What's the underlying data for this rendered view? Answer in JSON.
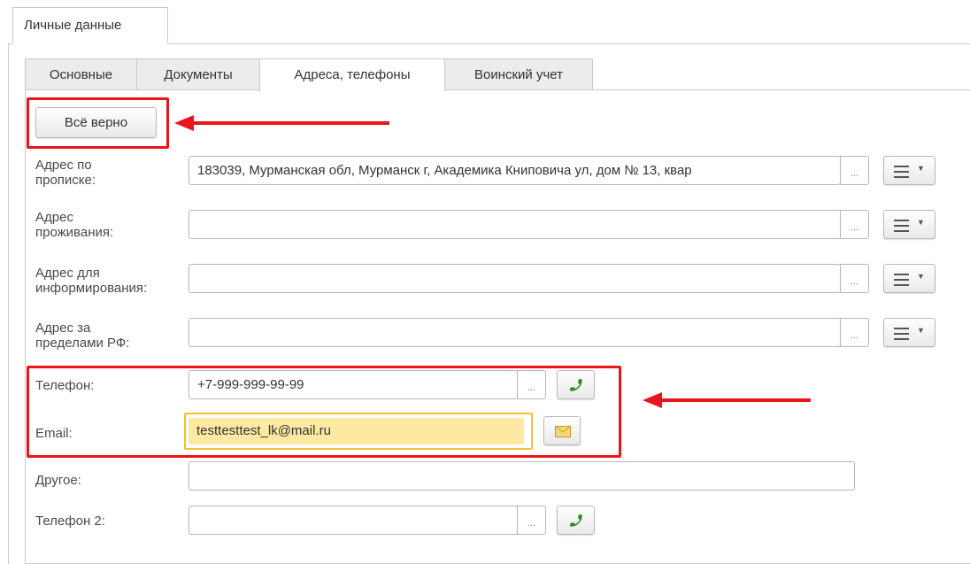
{
  "outer_tab": {
    "label": "Личные данные"
  },
  "tabs": [
    {
      "label": "Основные"
    },
    {
      "label": "Документы"
    },
    {
      "label": "Адреса, телефоны"
    },
    {
      "label": "Воинский учет"
    }
  ],
  "confirm_button": {
    "label": "Всё верно"
  },
  "fields": {
    "reg_address": {
      "label": "Адрес по прописке:",
      "value": "183039, Мурманская обл, Мурманск г, Академика Книповича ул, дом № 13, квар"
    },
    "live_address": {
      "label": "Адрес проживания:",
      "value": ""
    },
    "info_address": {
      "label": "Адрес для информирования:",
      "value": ""
    },
    "foreign_address": {
      "label": "Адрес за пределами РФ:",
      "value": ""
    },
    "phone": {
      "label": "Телефон:",
      "value": "+7-999-999-99-99"
    },
    "email": {
      "label": "Email:",
      "value": "testtesttest_lk@mail.ru"
    },
    "other": {
      "label": "Другое:",
      "value": ""
    },
    "phone2": {
      "label": "Телефон 2:",
      "value": ""
    }
  },
  "dots_label": "...",
  "icons": {
    "menu": "menu-icon",
    "phone": "phone-icon",
    "email": "envelope-icon",
    "caret": "chevron-down-icon"
  },
  "colors": {
    "annotation": "#e8151b",
    "email_highlight": "#fde9a1",
    "email_border": "#f2c12e",
    "phone_icon": "#2b8a1e"
  }
}
